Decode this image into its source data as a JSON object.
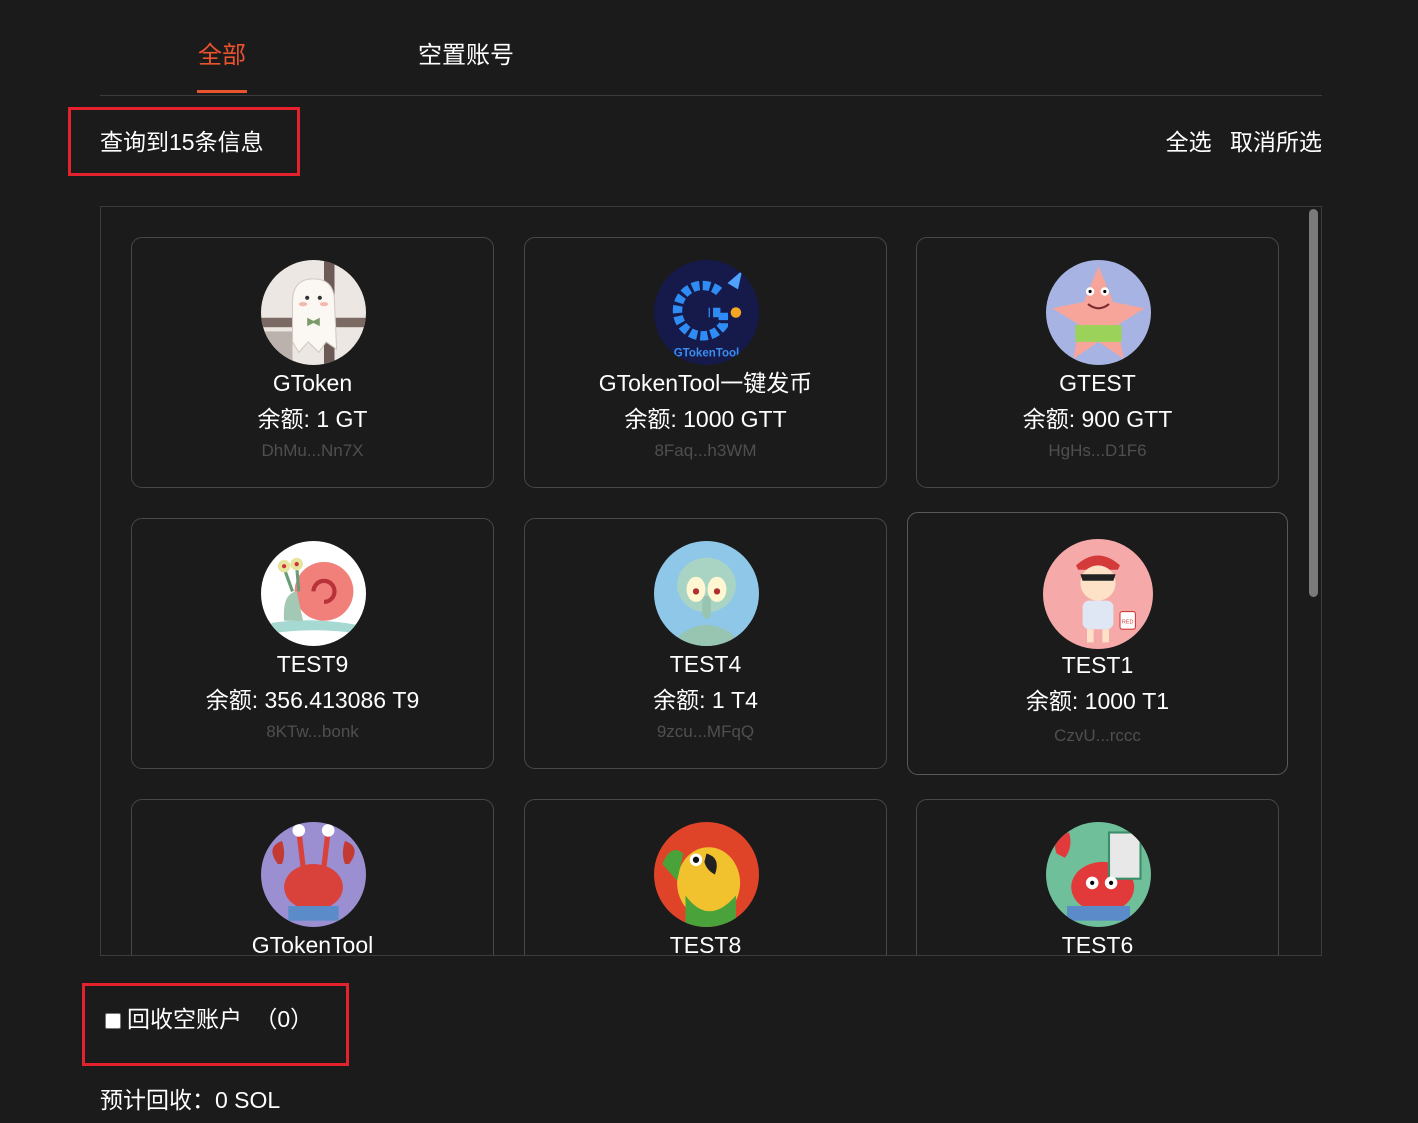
{
  "tabs": [
    {
      "label": "全部",
      "active": true
    },
    {
      "label": "空置账号",
      "active": false
    }
  ],
  "result_count": "查询到15条信息",
  "actions": {
    "select_all": "全选",
    "deselect_all": "取消所选"
  },
  "tokens": [
    {
      "name": "GToken",
      "balance": "余额: 1 GT",
      "address": "DhMu...Nn7X",
      "avatar": "ghost-doll-avatar"
    },
    {
      "name": "GTokenTool一键发币",
      "balance": "余额: 1000 GTT",
      "address": "8Faq...h3WM",
      "avatar": "gtokentool-logo-avatar"
    },
    {
      "name": "GTEST",
      "balance": "余额: 900 GTT",
      "address": "HgHs...D1F6",
      "avatar": "patrick-star-avatar"
    },
    {
      "name": "TEST9",
      "balance": "余额: 356.413086 T9",
      "address": "8KTw...bonk",
      "avatar": "snail-avatar"
    },
    {
      "name": "TEST4",
      "balance": "余额: 1 T4",
      "address": "9zcu...MFqQ",
      "avatar": "squidward-avatar"
    },
    {
      "name": "TEST1",
      "balance": "余额: 1000 T1",
      "address": "CzvU...rccc",
      "avatar": "shinchan-avatar"
    },
    {
      "name": "GTokenTool",
      "avatar": "mr-krabs-avatar"
    },
    {
      "name": "TEST8",
      "avatar": "parrot-avatar"
    },
    {
      "name": "TEST6",
      "avatar": "crab-money-avatar"
    }
  ],
  "recycle": {
    "label": "回收空账户",
    "count": "（0）",
    "checked": false
  },
  "estimate": "预计回收：0 SOL",
  "colors": {
    "accent": "#e9532d",
    "highlight": "#e3222e",
    "background": "#1b1b1b",
    "border": "#474747"
  }
}
